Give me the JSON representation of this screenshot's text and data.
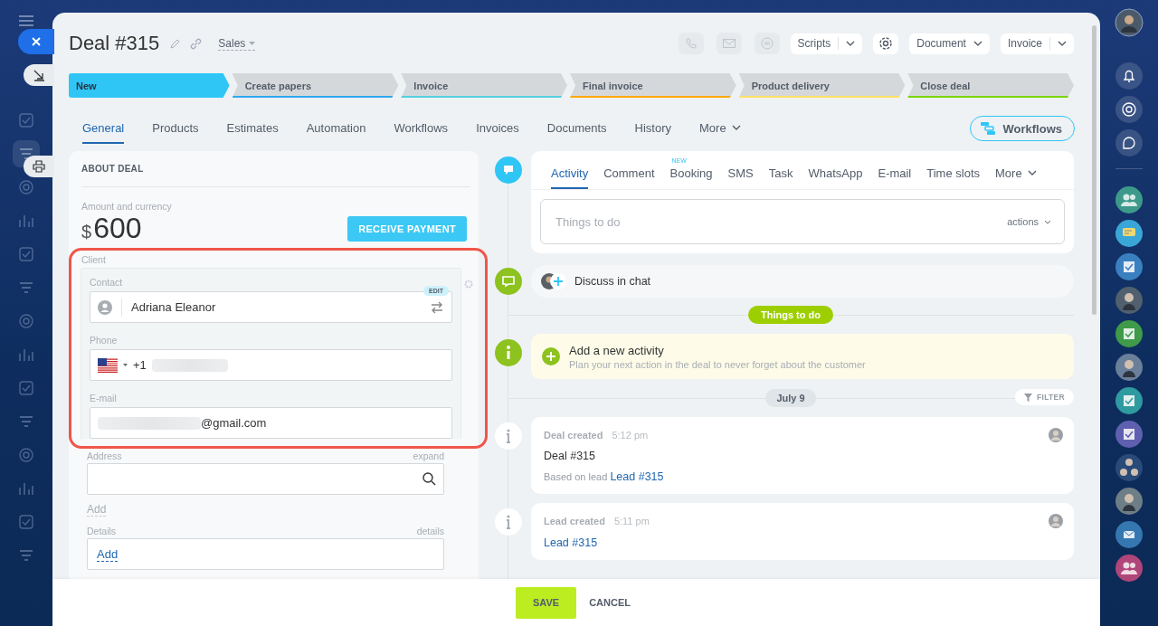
{
  "window": {
    "title": "Deal #315",
    "pipeline": "Sales"
  },
  "toolbar": [
    {
      "kind": "split",
      "label": "Scripts"
    },
    {
      "kind": "settings"
    },
    {
      "kind": "dropdown",
      "label": "Document"
    },
    {
      "kind": "split",
      "label": "Invoice"
    }
  ],
  "stages": [
    {
      "label": "New",
      "selected": true,
      "color": "#2fc6f6"
    },
    {
      "label": "Create papers",
      "selected": false,
      "color": "#2fa8f0"
    },
    {
      "label": "Invoice",
      "selected": false,
      "color": "#55d0e0"
    },
    {
      "label": "Final invoice",
      "selected": false,
      "color": "#ffa900"
    },
    {
      "label": "Product delivery",
      "selected": false,
      "color": "#ffe066"
    },
    {
      "label": "Close deal",
      "selected": false,
      "color": "#7bd500"
    }
  ],
  "tabs": [
    {
      "label": "General",
      "selected": true,
      "kind": "tab"
    },
    {
      "label": "Products",
      "selected": false,
      "kind": "tab"
    },
    {
      "label": "Estimates",
      "selected": false,
      "kind": "tab"
    },
    {
      "label": "Automation",
      "selected": false,
      "kind": "tab"
    },
    {
      "label": "Workflows",
      "selected": false,
      "kind": "tab"
    },
    {
      "label": "Invoices",
      "selected": false,
      "kind": "tab"
    },
    {
      "label": "Documents",
      "selected": false,
      "kind": "tab"
    },
    {
      "label": "History",
      "selected": false,
      "kind": "tab"
    },
    {
      "label": "More",
      "selected": false,
      "kind": "more"
    }
  ],
  "workflows_button": "Workflows",
  "about": {
    "title": "ABOUT DEAL",
    "amount_label": "Amount and currency",
    "currency": "$",
    "amount": "600",
    "payment_button": "RECEIVE PAYMENT"
  },
  "client": {
    "label": "Client",
    "highlighted": true,
    "contact": {
      "label": "Contact",
      "value": "Adriana Eleanor",
      "badge": "EDIT"
    },
    "phone": {
      "label": "Phone",
      "prefix": "+1"
    },
    "email": {
      "label": "E-mail",
      "value": "@gmail.com"
    }
  },
  "address": {
    "label": "Address",
    "action": "expand",
    "add": "Add"
  },
  "details": {
    "label": "Details",
    "action": "details",
    "value": "Add"
  },
  "activity": {
    "tabs": [
      {
        "label": "Activity",
        "selected": true
      },
      {
        "label": "Comment",
        "selected": false
      },
      {
        "label": "Booking",
        "selected": false,
        "badge": "NEW"
      },
      {
        "label": "SMS",
        "selected": false
      },
      {
        "label": "Task",
        "selected": false
      },
      {
        "label": "WhatsApp",
        "selected": false
      },
      {
        "label": "E-mail",
        "selected": false
      },
      {
        "label": "Time slots",
        "selected": false
      },
      {
        "label": "More",
        "selected": false,
        "kind": "more"
      }
    ],
    "placeholder": "Things to do",
    "actions": "actions"
  },
  "chat": "Discuss in chat",
  "todo_badge": "Things to do",
  "new_activity": {
    "title": "Add a new activity",
    "hint": "Plan your next action in the deal to never forget about the customer"
  },
  "date": "July 9",
  "filter": "FILTER",
  "history": [
    {
      "title": "Deal created",
      "time": "5:12 pm",
      "body": "Deal #315",
      "note": "Based on lead",
      "link": "Lead #315"
    },
    {
      "title": "Lead created",
      "time": "5:11 pm",
      "link": "Lead #315"
    }
  ],
  "footer": {
    "save": "SAVE",
    "cancel": "CANCEL"
  },
  "right_rail": [
    {
      "kind": "group",
      "color": "#3d9a8a"
    },
    {
      "kind": "chat",
      "color": "#3aa6d8"
    },
    {
      "kind": "task",
      "color": "#3a7fc0"
    },
    {
      "kind": "person",
      "color": "#51606e"
    },
    {
      "kind": "task",
      "color": "#3f9a4a"
    },
    {
      "kind": "person",
      "color": "#6a7f9a"
    },
    {
      "kind": "task",
      "color": "#2f9aa0"
    },
    {
      "kind": "task",
      "color": "#5f5fb0"
    },
    {
      "kind": "people",
      "color": "#2a4a7a"
    },
    {
      "kind": "person",
      "color": "#6e7e86"
    },
    {
      "kind": "mail",
      "color": "#3577b0"
    },
    {
      "kind": "group",
      "color": "#b0457a"
    }
  ]
}
